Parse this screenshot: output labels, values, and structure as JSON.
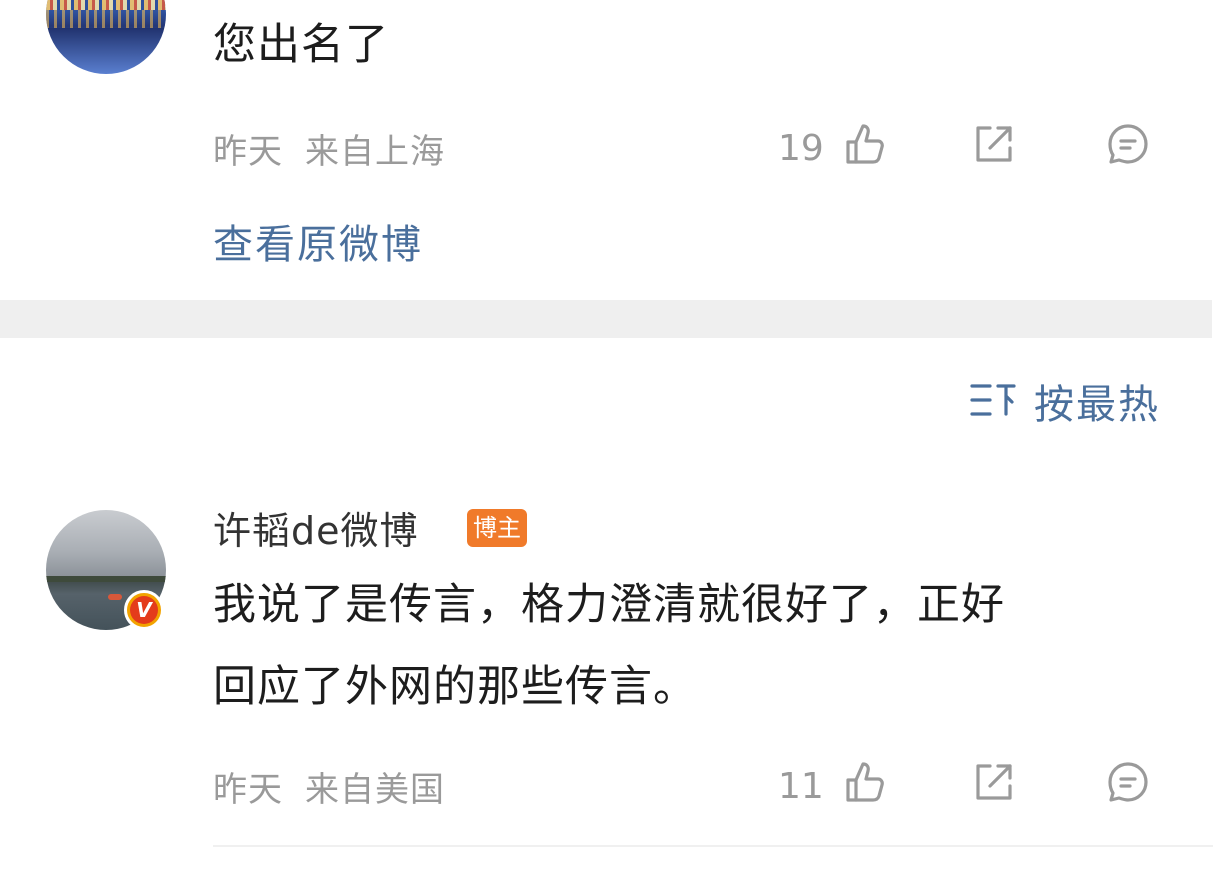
{
  "top_comment": {
    "text": "您出名了",
    "time": "昨天",
    "location": "来自上海",
    "likes": "19"
  },
  "view_original_label": "查看原微博",
  "sort": {
    "label": "按最热"
  },
  "second_comment": {
    "username": "许韬de微博",
    "badge": "博主",
    "verified_mark": "V",
    "text_line1": "我说了是传言，格力澄清就很好了，正好",
    "text_line2": "回应了外网的那些传言。",
    "time": "昨天",
    "location": "来自美国",
    "likes": "11"
  },
  "colors": {
    "link": "#4a6f9c",
    "meta": "#9a9a9a",
    "badge_host": "#f07a2a",
    "verified_outer": "#f2a300",
    "verified_inner": "#e43b1b"
  },
  "icons": [
    "like-icon",
    "repost-icon",
    "comment-icon",
    "sort-icon",
    "verified-icon"
  ]
}
